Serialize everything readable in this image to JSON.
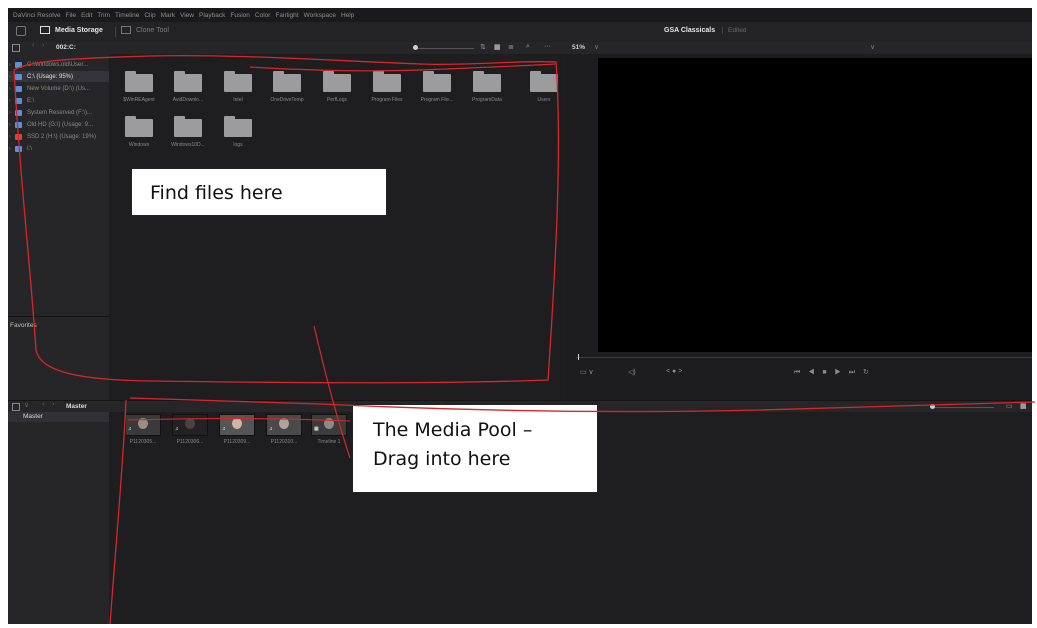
{
  "menubar": {
    "items": [
      "DaVinci Resolve",
      "File",
      "Edit",
      "Trim",
      "Timeline",
      "Clip",
      "Mark",
      "View",
      "Playback",
      "Fusion",
      "Color",
      "Fairlight",
      "Workspace",
      "Help"
    ]
  },
  "toolbar": {
    "media_storage_label": "Media Storage",
    "clone_tool_label": "Clone Tool",
    "project_title": "GSA Classicals",
    "project_status": "Edited"
  },
  "media_storage": {
    "path": "002:C:",
    "drives": [
      {
        "label": "G:\\Windows.old\\User...",
        "color": "blue"
      },
      {
        "label": "C:\\ (Usage: 95%)",
        "color": "blue",
        "selected": true
      },
      {
        "label": "New Volume (D:\\) (Us...",
        "color": "blue"
      },
      {
        "label": "E:\\",
        "color": "blue"
      },
      {
        "label": "System Reserved (F:\\)...",
        "color": "blue"
      },
      {
        "label": "Old HD (G:\\) (Usage: 9...",
        "color": "blue"
      },
      {
        "label": "SSD 2 (H:\\) (Usage: 19%)",
        "color": "red"
      },
      {
        "label": "I:\\",
        "color": "blue"
      }
    ],
    "favorites_label": "Favorites",
    "folders": [
      "$WinREAgent",
      "AvidDownlo...",
      "Intel",
      "OneDriveTemp",
      "PerfLogs",
      "Program Files",
      "Program File...",
      "ProgramData",
      "Users",
      "Windows",
      "Windows10D...",
      "logs"
    ]
  },
  "viewer": {
    "zoom": "51%",
    "controls": [
      "▭ ∨",
      "◁)",
      "< ● >",
      "⏮ ◀ ■ ▶ ⏭ ↻"
    ]
  },
  "media_pool": {
    "bin_title": "Master",
    "bins": [
      "Master"
    ],
    "clips": [
      {
        "label": "P1120305...",
        "badge": "♫"
      },
      {
        "label": "P1120306...",
        "badge": "♫"
      },
      {
        "label": "P1120309...",
        "badge": "♫"
      },
      {
        "label": "P1120310...",
        "badge": "♫"
      },
      {
        "label": "Timeline 1",
        "badge": "▦"
      }
    ]
  },
  "annotations": {
    "callout_find": "Find files here",
    "callout_pool_line1": "The Media Pool –",
    "callout_pool_line2": "Drag into here"
  },
  "colors": {
    "app_bg": "#1f1f21",
    "panel_bg": "#262628",
    "drive_blue": "#5b8fd9",
    "drive_red": "#d9473b",
    "annotation_red": "#d8262a"
  }
}
